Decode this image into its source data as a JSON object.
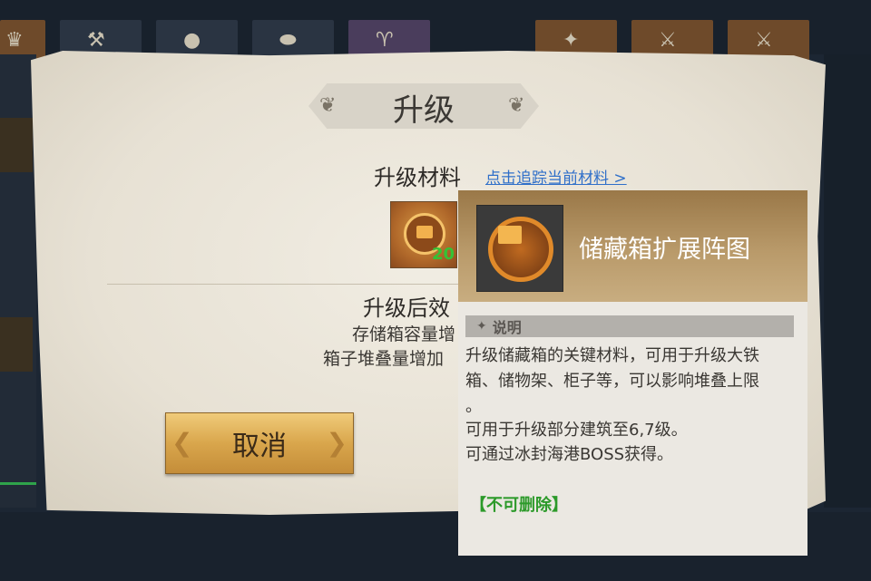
{
  "panel": {
    "title": "升级",
    "materials_label": "升级材料",
    "track_link": "点击追踪当前材料 >",
    "material_count": "20",
    "after_label": "升级后效",
    "effects": [
      "存储箱容量增",
      "箱子堆叠量增加"
    ],
    "cancel_label": "取消"
  },
  "tooltip": {
    "item_name": "储藏箱扩展阵图",
    "section_label": "说明",
    "description_lines": [
      "升级储藏箱的关键材料，可用于升级大铁",
      "箱、储物架、柜子等，可以影响堆叠上限",
      "。",
      "可用于升级部分建筑至6,7级。",
      "可通过冰封海港BOSS获得。"
    ],
    "flag": "【不可删除】"
  },
  "colors": {
    "link": "#2f6fc9",
    "count": "#35c236",
    "undeletable": "#2c9a2a",
    "button_gold": "#d9a64c"
  },
  "icons": {
    "material": "storage-chest-diagram-icon",
    "section": "diamond-icon"
  }
}
